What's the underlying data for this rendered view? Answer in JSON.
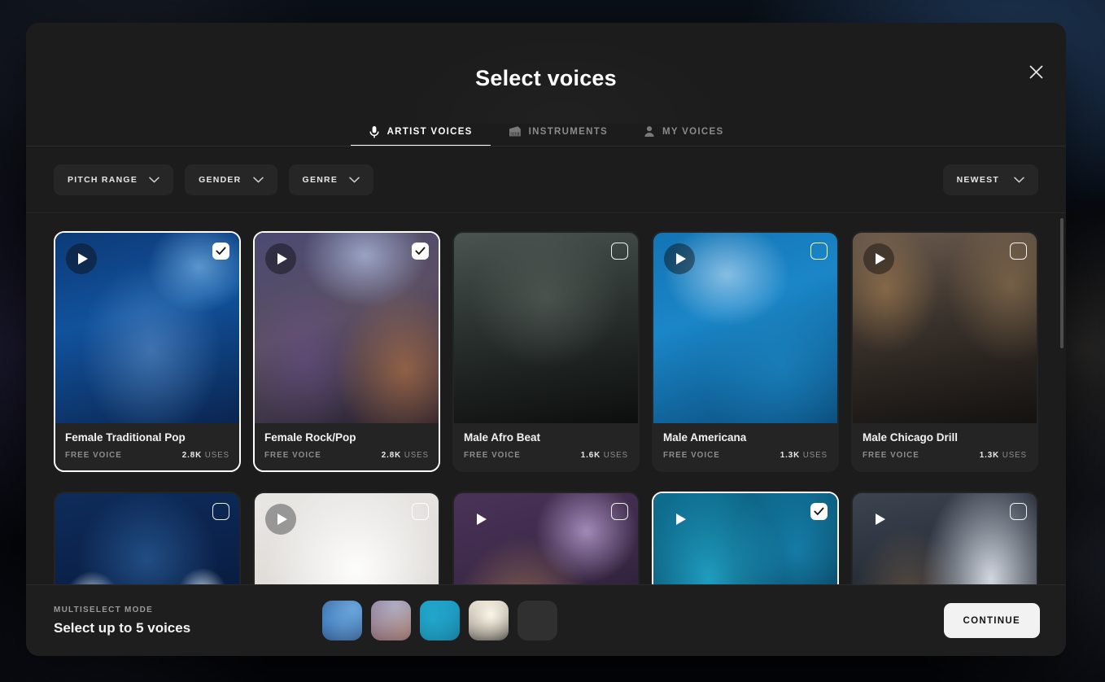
{
  "modal": {
    "title": "Select voices",
    "close_icon": "close-icon"
  },
  "tabs": [
    {
      "label": "ARTIST VOICES",
      "icon": "microphone-icon",
      "active": true
    },
    {
      "label": "INSTRUMENTS",
      "icon": "piano-icon",
      "active": false
    },
    {
      "label": "MY VOICES",
      "icon": "person-icon",
      "active": false
    }
  ],
  "filters": [
    {
      "label": "PITCH RANGE",
      "icon": "chevron-down-icon"
    },
    {
      "label": "GENDER",
      "icon": "chevron-down-icon"
    },
    {
      "label": "GENRE",
      "icon": "chevron-down-icon"
    }
  ],
  "sort": {
    "label": "NEWEST",
    "icon": "chevron-down-icon"
  },
  "cards": [
    {
      "name": "Female Traditional Pop",
      "tier": "FREE VOICE",
      "uses_count": "2.8K",
      "uses_label": "USES",
      "selected": true,
      "play_style": "dark",
      "art": "blue-stage-female-singer-piano"
    },
    {
      "name": "Female Rock/Pop",
      "tier": "FREE VOICE",
      "uses_count": "2.8K",
      "uses_label": "USES",
      "selected": true,
      "play_style": "dark",
      "art": "warm-stage-female-rock-singer"
    },
    {
      "name": "Male Afro Beat",
      "tier": "FREE VOICE",
      "uses_count": "1.6K",
      "uses_label": "USES",
      "selected": false,
      "play_style": "none",
      "art": "dark-portrait-male-headphones"
    },
    {
      "name": "Male Americana",
      "tier": "FREE VOICE",
      "uses_count": "1.3K",
      "uses_label": "USES",
      "selected": false,
      "play_style": "dark",
      "art": "blue-cowboy-hat-male-singer"
    },
    {
      "name": "Male Chicago Drill",
      "tier": "FREE VOICE",
      "uses_count": "1.3K",
      "uses_label": "USES",
      "selected": false,
      "play_style": "dark",
      "art": "warehouse-male-crossed-arms"
    },
    {
      "name": "",
      "tier": "",
      "uses_count": "",
      "uses_label": "",
      "selected": false,
      "play_style": "none",
      "art": "blue-stage-male-singer-mic"
    },
    {
      "name": "",
      "tier": "",
      "uses_count": "",
      "uses_label": "",
      "selected": false,
      "play_style": "light",
      "art": "bright-white-male-singer"
    },
    {
      "name": "",
      "tier": "",
      "uses_count": "",
      "uses_label": "",
      "selected": false,
      "play_style": "bare",
      "art": "purple-stage-female-curly-singer"
    },
    {
      "name": "",
      "tier": "",
      "uses_count": "",
      "uses_label": "",
      "selected": true,
      "play_style": "bare",
      "art": "cyan-stage-male-singer"
    },
    {
      "name": "",
      "tier": "",
      "uses_count": "",
      "uses_label": "",
      "selected": false,
      "play_style": "bare",
      "art": "window-light-male-singer"
    }
  ],
  "footer": {
    "kicker": "MULTISELECT MODE",
    "title": "Select up to 5 voices",
    "continue_label": "CONTINUE",
    "slots": [
      {
        "art": "blue-stage-female-singer-piano",
        "empty": false
      },
      {
        "art": "warm-stage-female-rock-singer",
        "empty": false
      },
      {
        "art": "cyan-stage-male-singer",
        "empty": false
      },
      {
        "art": "bright-backlit-female-singer",
        "empty": false
      },
      {
        "art": "",
        "empty": true
      }
    ]
  },
  "colors": {
    "modal_bg": "#1c1c1c",
    "card_bg": "#242424",
    "accent_white": "#ffffff",
    "muted_text": "#8d8d8d",
    "footer_bg": "#1e1e1e"
  }
}
